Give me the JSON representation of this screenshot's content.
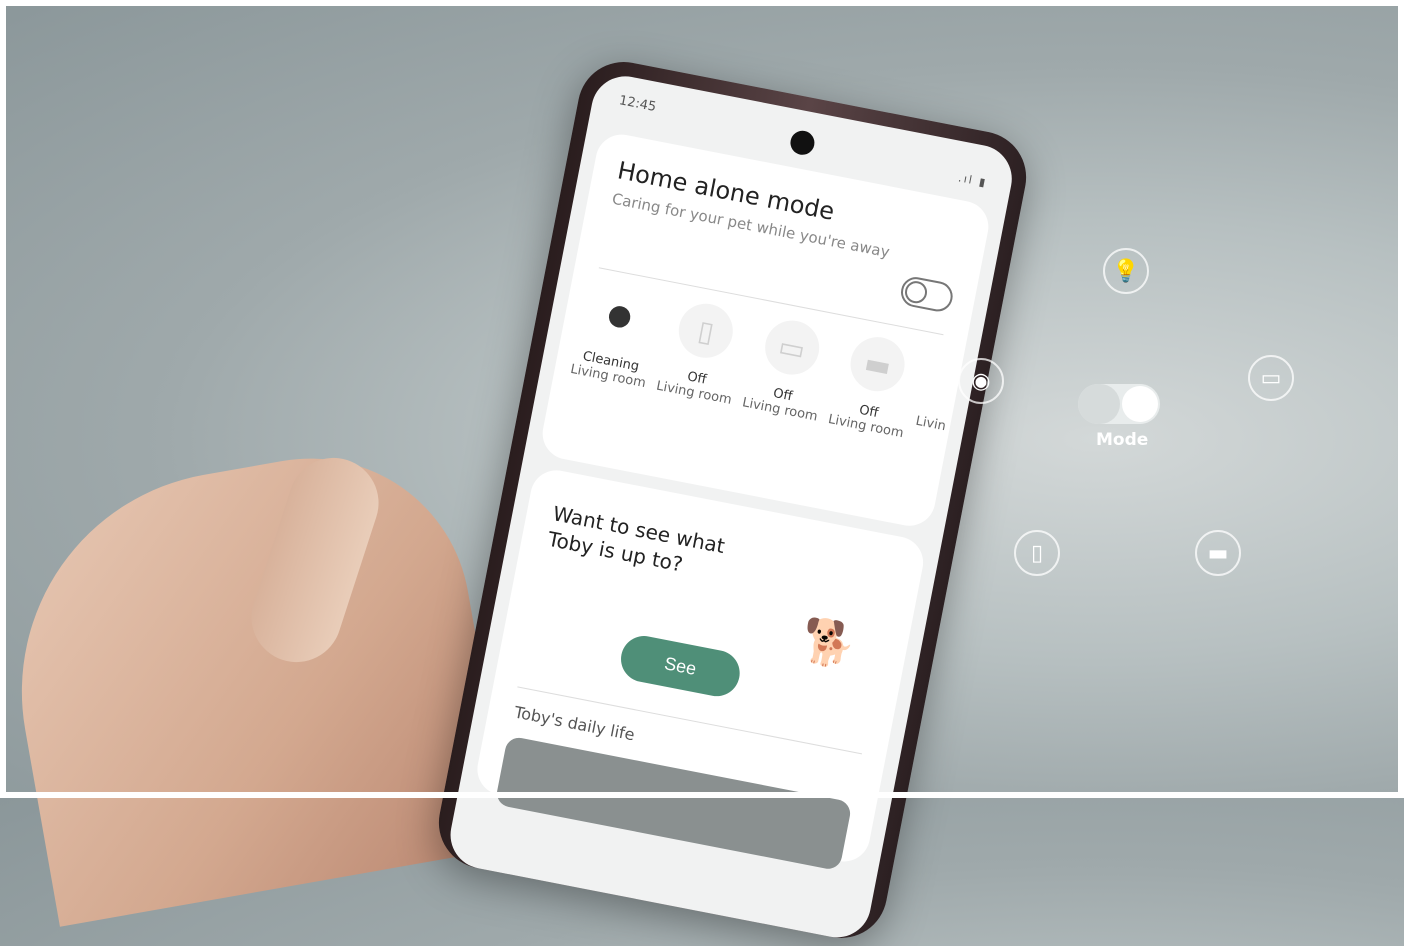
{
  "status": {
    "time": "12:45",
    "icons": ".ıl ▮"
  },
  "mode_card": {
    "title": "Home alone mode",
    "subtitle": "Caring for your pet while you're away",
    "toggle_on": false,
    "devices": [
      {
        "icon": "robot-vacuum-icon",
        "state": "Cleaning",
        "room": "Living room",
        "active": true
      },
      {
        "icon": "air-purifier-icon",
        "state": "Off",
        "room": "Living room",
        "active": false
      },
      {
        "icon": "air-conditioner-icon",
        "state": "Off",
        "room": "Living room",
        "active": false
      },
      {
        "icon": "tv-icon",
        "state": "Off",
        "room": "Living room",
        "active": false
      },
      {
        "icon": "device-icon",
        "state": "",
        "room": "Livin",
        "active": false
      }
    ]
  },
  "toby_card": {
    "question": "Want to see what\nToby is up to?",
    "see_button": "See",
    "daily_title": "Toby's daily life"
  },
  "overlay": {
    "mode_label": "Mode",
    "icons": [
      "lightbulb-icon",
      "robot-vacuum-icon",
      "tv-icon",
      "air-purifier-icon",
      "air-conditioner-icon"
    ]
  }
}
